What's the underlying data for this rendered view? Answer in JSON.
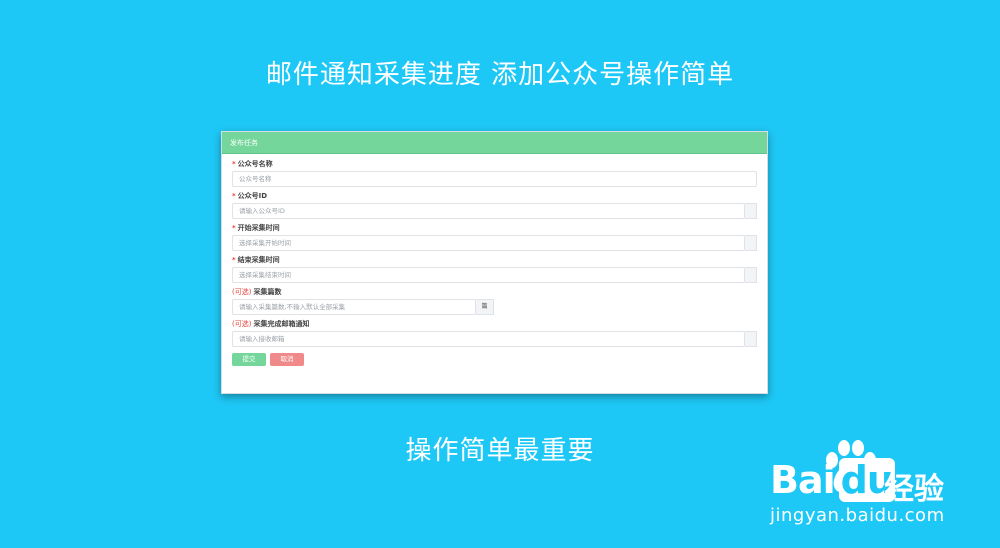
{
  "headline_top": "邮件通知采集进度 添加公众号操作简单",
  "headline_bottom": "操作简单最重要",
  "panel": {
    "title": "发布任务",
    "fields": [
      {
        "marker": "*",
        "label": "公众号名称",
        "placeholder": "公众号名称"
      },
      {
        "marker": "*",
        "label": "公众号ID",
        "placeholder": "请输入公众号ID"
      },
      {
        "marker": "*",
        "label": "开始采集时间",
        "placeholder": "选择采集开始时间"
      },
      {
        "marker": "*",
        "label": "结束采集时间",
        "placeholder": "选择采集结束时间"
      },
      {
        "marker": "(可选)",
        "label": "采集篇数",
        "placeholder": "请输入采集篇数,不输入默认全部采集",
        "addon": "篇"
      },
      {
        "marker": "(可选)",
        "label": "采集完成邮箱通知",
        "placeholder": "请输入接收邮箱"
      }
    ],
    "submit_label": "提交",
    "cancel_label": "取消"
  },
  "watermark": {
    "brand_latin_1": "Bai",
    "brand_latin_2": "du",
    "brand_cn": "经验",
    "url": "jingyan.baidu.com"
  },
  "colors": {
    "background": "#1ec8f6",
    "header": "#74d69a",
    "submit": "#74d69a",
    "cancel": "#f08a8a",
    "required": "#e8443a"
  }
}
